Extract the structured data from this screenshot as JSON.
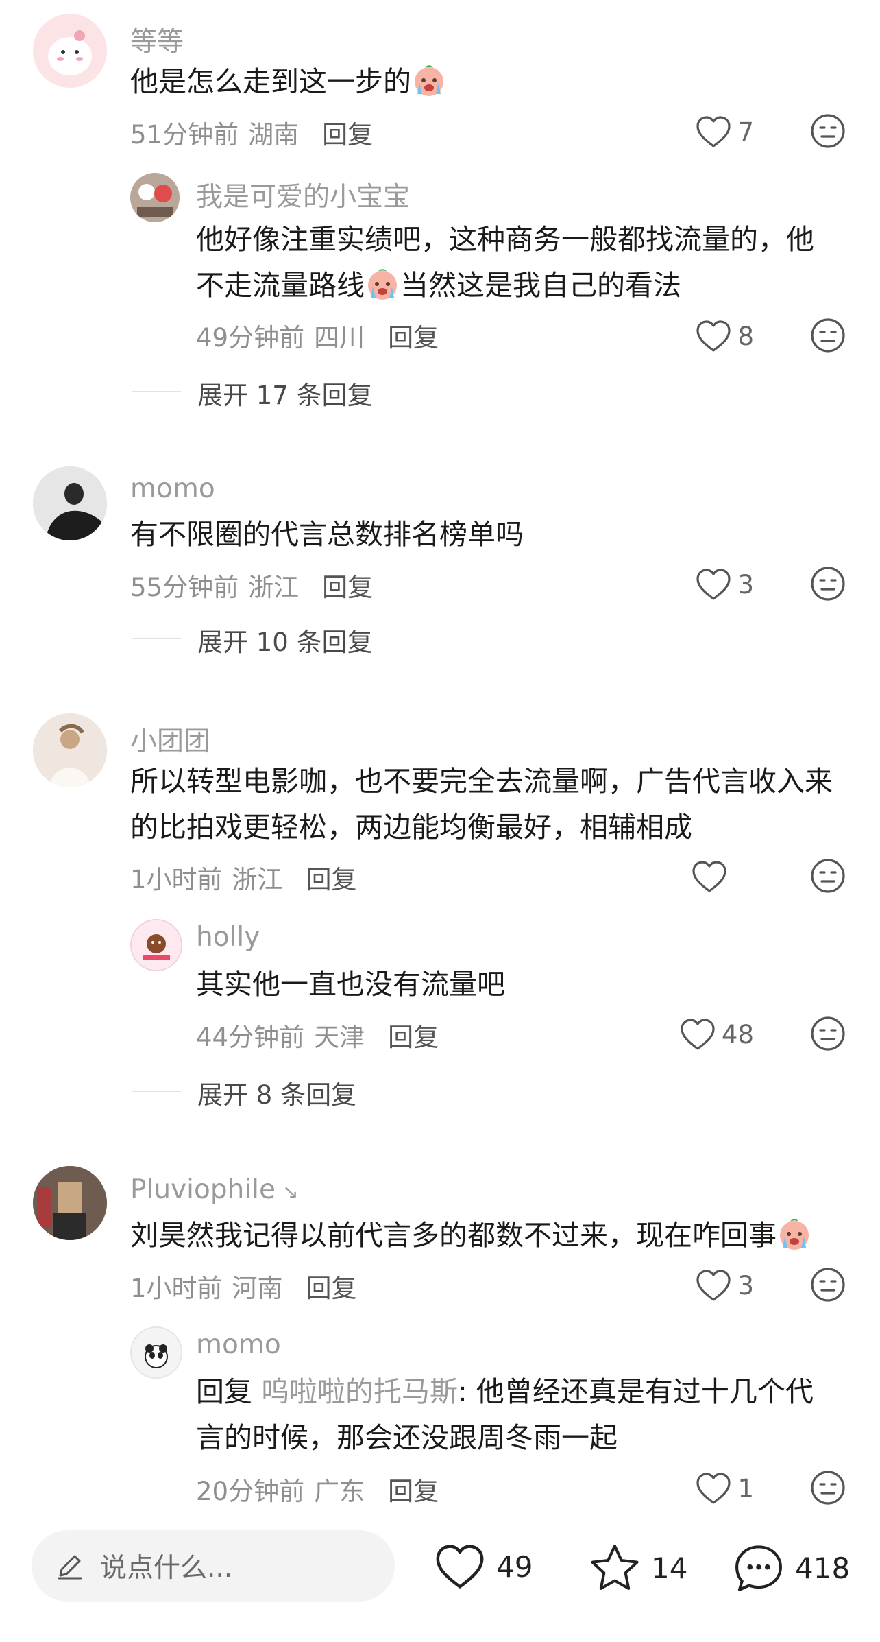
{
  "comments": [
    {
      "author": "等等",
      "text": "他是怎么走到这一步的",
      "time": "51分钟前",
      "location": "湖南",
      "reply_label": "回复",
      "likes": "7",
      "replies": [
        {
          "author": "我是可爱的小宝宝",
          "text_line1": "他好像注重实绩吧，这种商务一般都找流量的，他",
          "text_line2a": "不走流量路线",
          "text_line2b": "当然这是我自己的看法",
          "time": "49分钟前",
          "location": "四川",
          "reply_label": "回复",
          "likes": "8"
        }
      ],
      "expand": "展开 17 条回复"
    },
    {
      "author": "momo",
      "text": "有不限圈的代言总数排名榜单吗",
      "time": "55分钟前",
      "location": "浙江",
      "reply_label": "回复",
      "likes": "3",
      "expand": "展开 10 条回复"
    },
    {
      "author": "小团团",
      "text_line1": "所以转型电影咖，也不要完全去流量啊，广告代言收入来",
      "text_line2": "的比拍戏更轻松，两边能均衡最好，相辅相成",
      "time": "1小时前",
      "location": "浙江",
      "reply_label": "回复",
      "likes": "",
      "replies": [
        {
          "author": "holly",
          "text": "其实他一直也没有流量吧",
          "time": "44分钟前",
          "location": "天津",
          "reply_label": "回复",
          "likes": "48"
        }
      ],
      "expand": "展开 8 条回复"
    },
    {
      "author": "Pluviophile",
      "author_suffix": "↘",
      "text": "刘昊然我记得以前代言多的都数不过来，现在咋回事",
      "time": "1小时前",
      "location": "河南",
      "reply_label": "回复",
      "likes": "3",
      "replies": [
        {
          "author": "momo",
          "reply_prefix": "回复 ",
          "reply_to": "呜啦啦的托马斯",
          "text_line1_rest": ": 他曾经还真是有过十几个代",
          "text_line2": "言的时候，那会还没跟周冬雨一起",
          "time": "20分钟前",
          "location": "广东",
          "reply_label": "回复",
          "likes": "1"
        }
      ]
    }
  ],
  "bottom_bar": {
    "placeholder": "说点什么...",
    "likes": "49",
    "favorites": "14",
    "comments": "418"
  },
  "icons": {
    "like": "heart-outline-icon",
    "dislike": "neutral-face-icon",
    "edit": "pencil-icon",
    "favorite": "star-icon",
    "comment": "chat-bubble-icon",
    "emoji": "crying-face-emoji"
  },
  "colors": {
    "name": "#9a9a9a",
    "text": "#1a1a1a",
    "meta": "#8f8f8f",
    "input_bg": "#f3f3f3"
  }
}
